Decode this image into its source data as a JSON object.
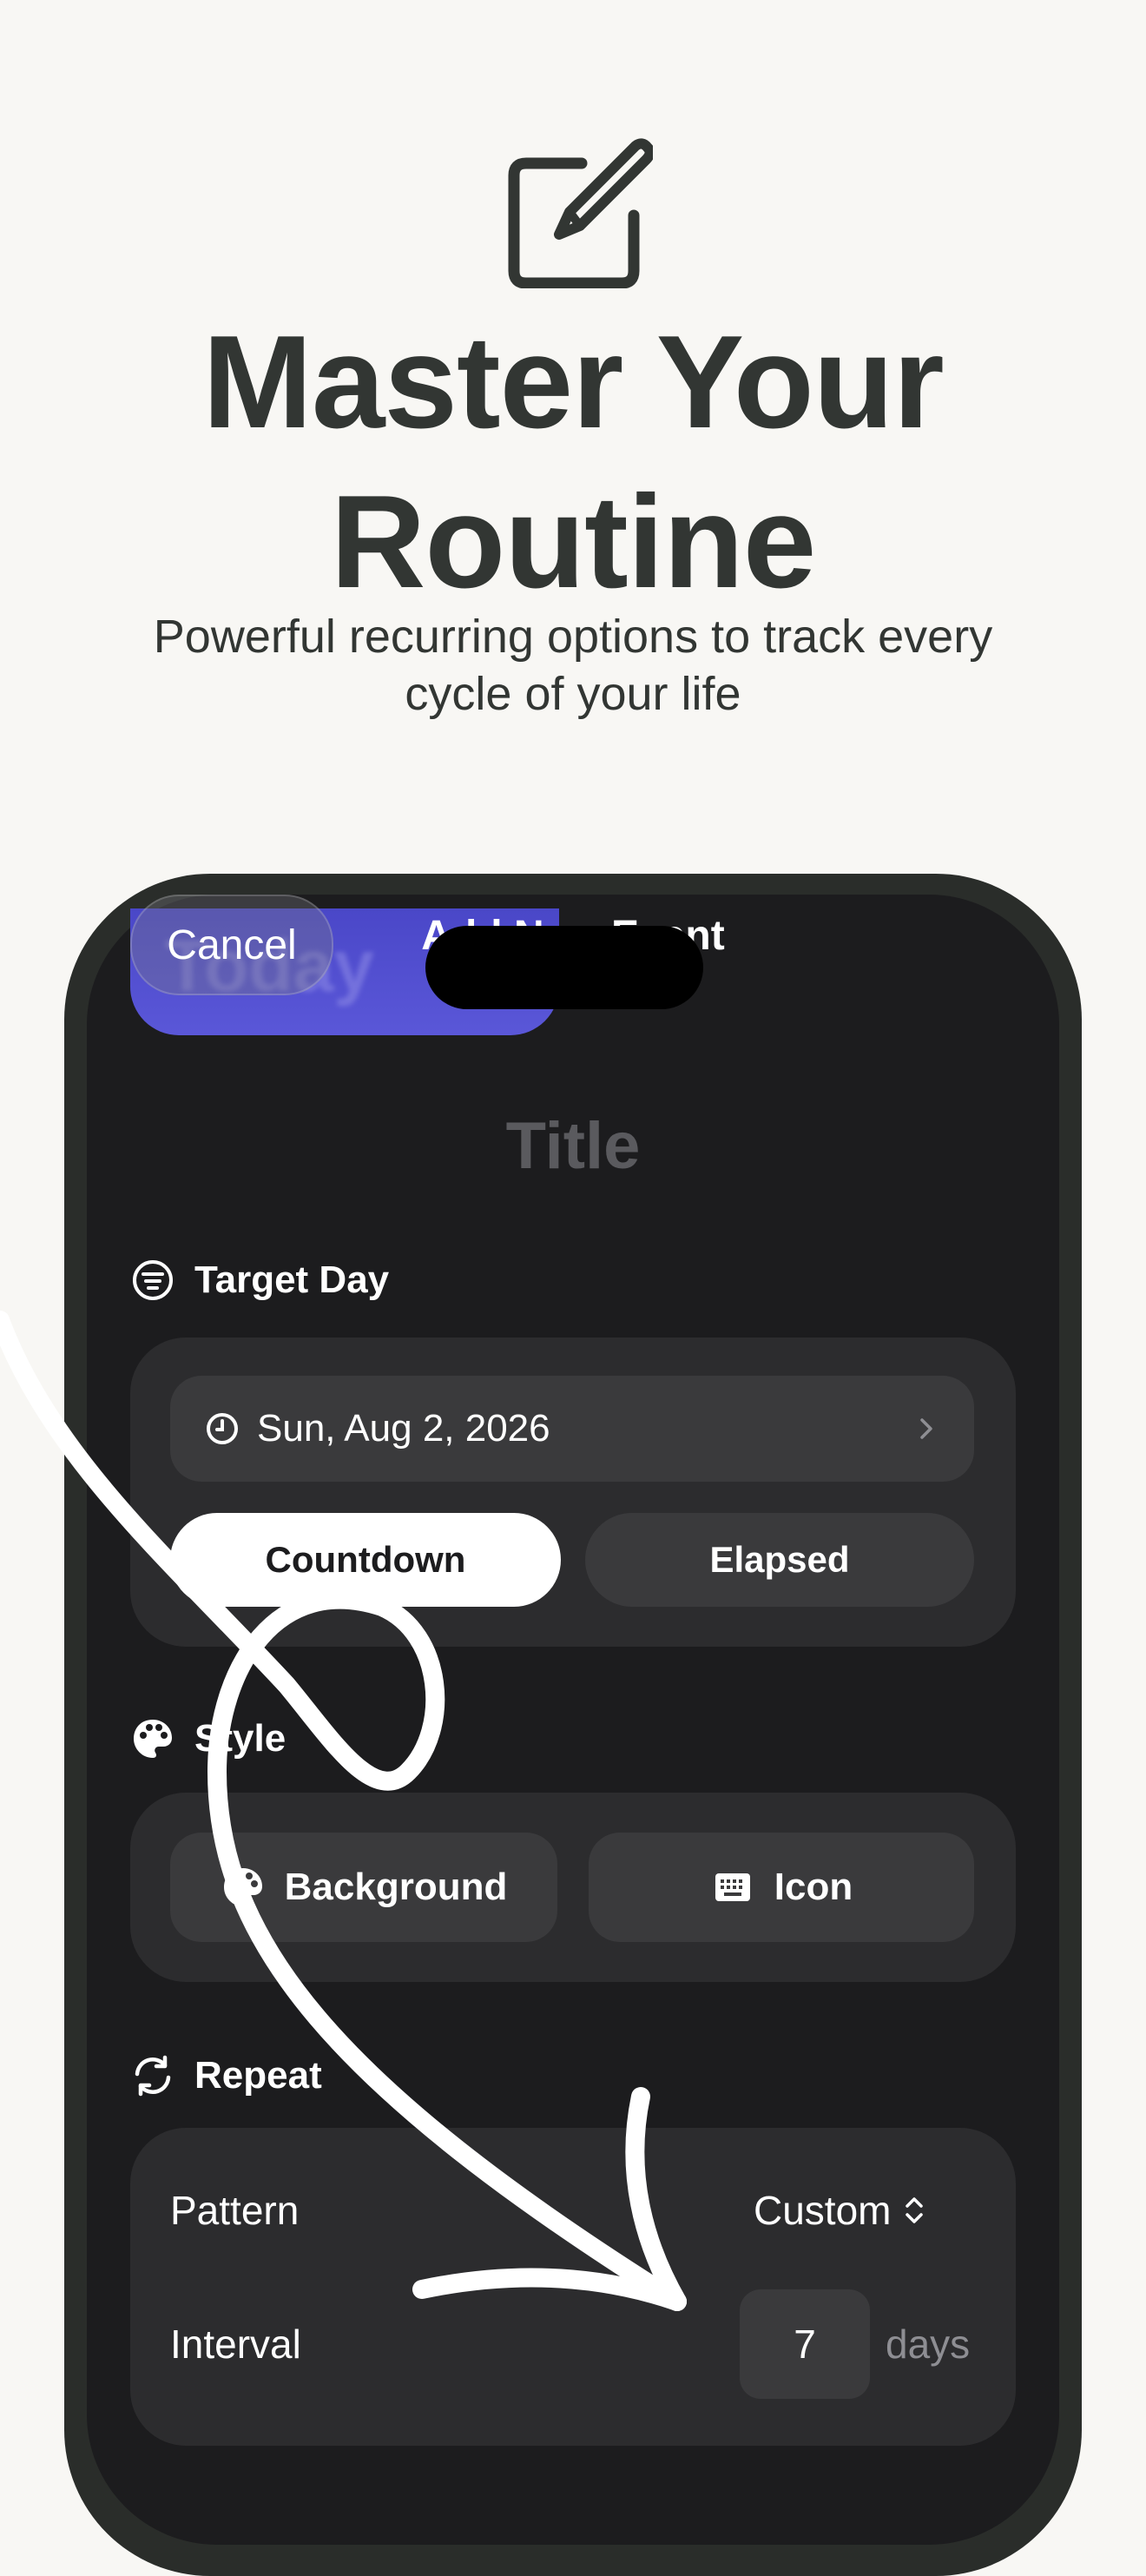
{
  "hero": {
    "title_line1": "Master Your",
    "title_line2": "Routine",
    "subtitle_line1": "Powerful recurring options to track every",
    "subtitle_line2": "cycle of your life",
    "icon": "edit-icon"
  },
  "nav": {
    "cancel_label": "Cancel",
    "title": "Add New Event",
    "background_card_label": "Today"
  },
  "form": {
    "title_placeholder": "Title",
    "target_day": {
      "header": "Target Day",
      "date": "Sun, Aug 2, 2026",
      "modes": [
        "Countdown",
        "Elapsed"
      ],
      "selected_mode": "Countdown"
    },
    "style": {
      "header": "Style",
      "background_label": "Background",
      "icon_label": "Icon"
    },
    "repeat": {
      "header": "Repeat",
      "pattern_label": "Pattern",
      "pattern_value": "Custom",
      "interval_label": "Interval",
      "interval_value": "7",
      "interval_unit": "days"
    }
  },
  "colors": {
    "page_bg": "#f8f7f4",
    "text_dark": "#323633",
    "screen_bg": "#1c1c1e",
    "card_bg": "#2c2c2e",
    "accent_purple": "#5a57d8"
  }
}
